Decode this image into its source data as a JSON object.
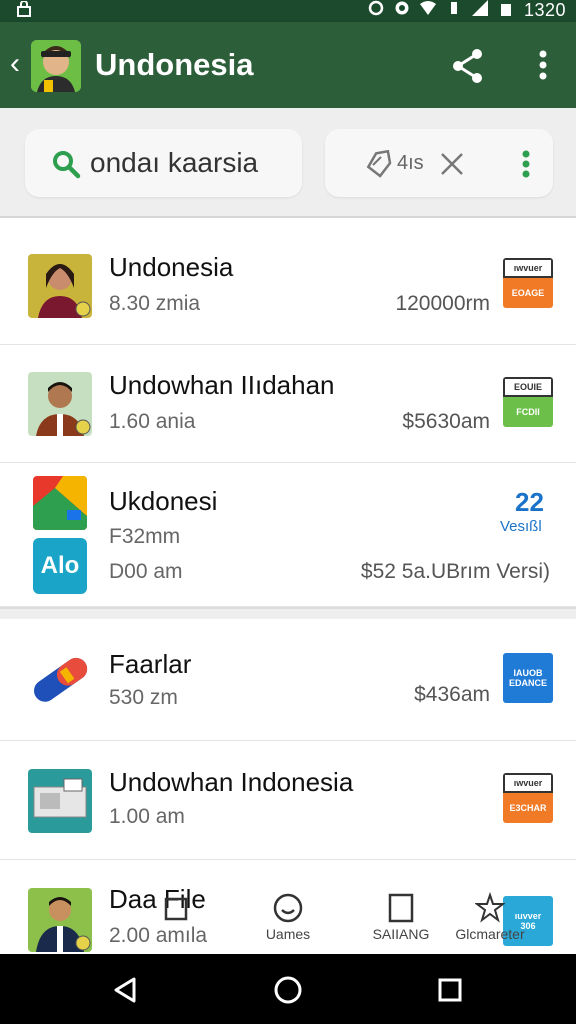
{
  "status_bar": {
    "time": "1320"
  },
  "app_bar": {
    "title": "Undonesia"
  },
  "search": {
    "value": "ondaı kaarsia",
    "filter_text": "4ıs"
  },
  "list": [
    {
      "title": "Undonesia",
      "sub": "8.30 zmia",
      "amount": "120000rm",
      "badge_color": "#f07a26",
      "badge_top": "ıwvuer",
      "badge_bottom": "EOAGE"
    },
    {
      "title": "Undowhan IIıdahan",
      "sub": "1.60 ania",
      "amount": "$5630am",
      "badge_color": "#6cc04a",
      "badge_top": "EOUIE",
      "badge_bottom": "FCDII"
    },
    {
      "title": "Ukdonesi",
      "sub": "F32mm",
      "sub2": "D00 am",
      "amount": "$52 5a.UBrım Versi)",
      "badge_number": "22",
      "badge_label": "Vesıßl",
      "icon_text": "Alo"
    },
    {
      "title": "Faarlar",
      "sub": "530 zm",
      "amount": "$436am",
      "badge_color": "#1f7bd6",
      "badge_top": "IAUOB",
      "badge_bottom": "EDANCE"
    },
    {
      "title": "Undowhan Indonesia",
      "sub": "1.00 am",
      "amount": "",
      "badge_color": "#f07a26",
      "badge_top": "ıwvuer",
      "badge_bottom": "E3CHAR"
    },
    {
      "title": "Daa File",
      "sub": "2.00 amıla",
      "amount": "",
      "badge_color": "#2aa8d8",
      "badge_top": "ıuvver",
      "badge_bottom": "306"
    }
  ],
  "tabs": [
    {
      "label": "Uames"
    },
    {
      "label": "SAIIANG"
    },
    {
      "label": "Glcmareter"
    }
  ],
  "colors": {
    "app_bar": "#2d5e3a",
    "status_bar": "#1b4a2c",
    "accent_green": "#2e9e4f"
  }
}
